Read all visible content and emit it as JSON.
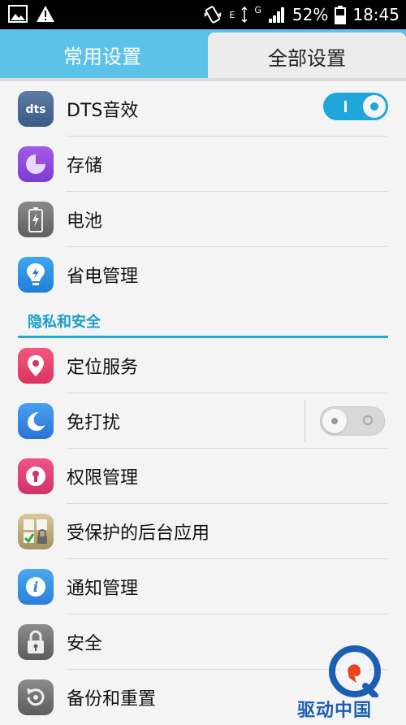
{
  "status_bar": {
    "battery": "52%",
    "time": "18:45",
    "signal_label_e": "E",
    "signal_label_g": "G"
  },
  "tabs": [
    {
      "label": "常用设置",
      "selected": false
    },
    {
      "label": "全部设置",
      "selected": true
    }
  ],
  "rows_top": [
    {
      "label": "DTS音效",
      "icon": "dts-icon",
      "toggle": "on"
    },
    {
      "label": "存储",
      "icon": "storage-icon"
    },
    {
      "label": "电池",
      "icon": "battery-icon"
    },
    {
      "label": "省电管理",
      "icon": "power-saving-icon"
    }
  ],
  "section": {
    "title": "隐私和安全"
  },
  "rows_privacy": [
    {
      "label": "定位服务",
      "icon": "location-icon"
    },
    {
      "label": "免打扰",
      "icon": "moon-icon",
      "toggle": "off"
    },
    {
      "label": "权限管理",
      "icon": "keyhole-icon"
    },
    {
      "label": "受保护的后台应用",
      "icon": "protected-apps-icon"
    },
    {
      "label": "通知管理",
      "icon": "info-icon"
    },
    {
      "label": "安全",
      "icon": "lock-icon"
    },
    {
      "label": "备份和重置",
      "icon": "backup-reset-icon"
    }
  ],
  "watermark": {
    "text": "驱动中国"
  },
  "colors": {
    "tab_bar": "#5cc2e8",
    "accent": "#1fa7dc"
  }
}
